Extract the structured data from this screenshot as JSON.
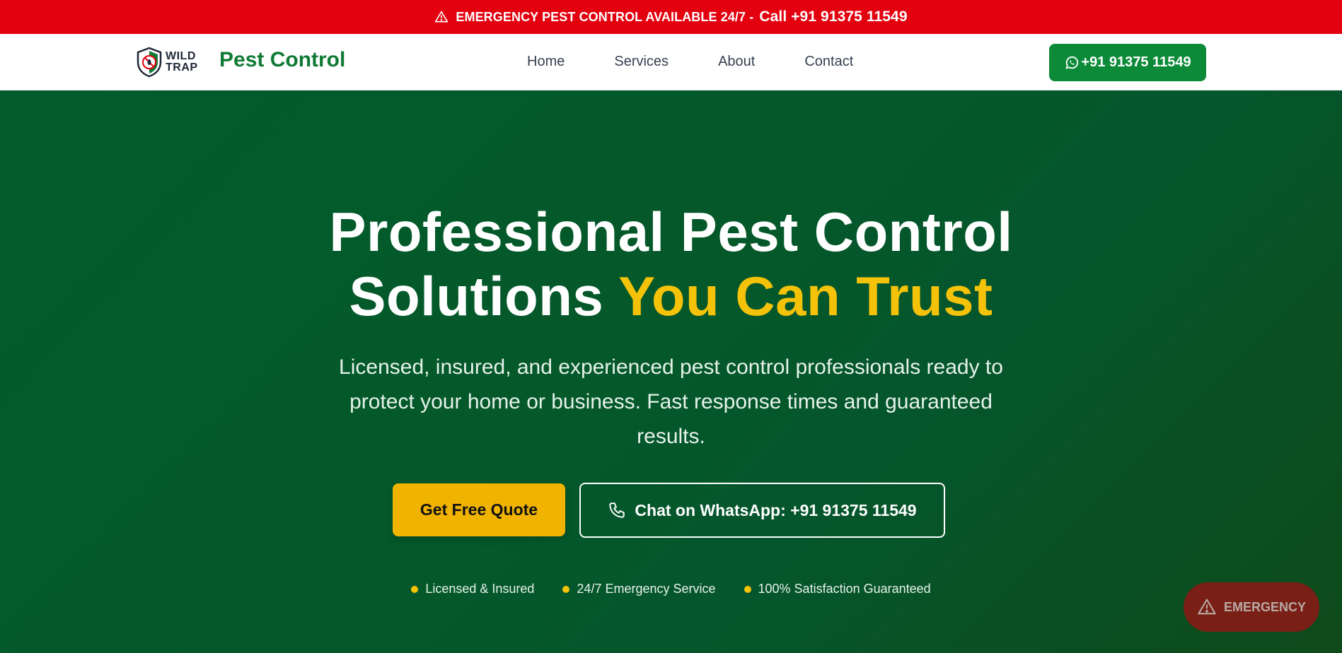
{
  "topbar": {
    "text": "EMERGENCY PEST CONTROL AVAILABLE 24/7 -",
    "call": "Call +91 91375 11549",
    "icon": "warning-triangle-icon",
    "color": "#e3000f"
  },
  "navbar": {
    "logo_line1": "WILD",
    "logo_line2": "TRAP",
    "brand": "Pest Control",
    "links": [
      "Home",
      "Services",
      "About",
      "Contact"
    ],
    "whatsapp_label": "+91 91375 11549",
    "accent": "#0c8a38"
  },
  "hero": {
    "title_line1": "Professional Pest Control",
    "title_line2_plain": "Solutions",
    "title_line2_accent": "You Can Trust",
    "lead": "Licensed, insured, and experienced pest control professionals ready to protect your home or business. Fast response times and guaranteed results.",
    "cta_primary": "Get Free Quote",
    "cta_secondary": "Chat on WhatsApp: +91 91375 11549",
    "badges": [
      "Licensed & Insured",
      "24/7 Emergency Service",
      "100% Satisfaction Guaranteed"
    ],
    "accent": "#f5c20a"
  },
  "fab": {
    "label": "EMERGENCY",
    "icon": "warning-triangle-icon"
  }
}
